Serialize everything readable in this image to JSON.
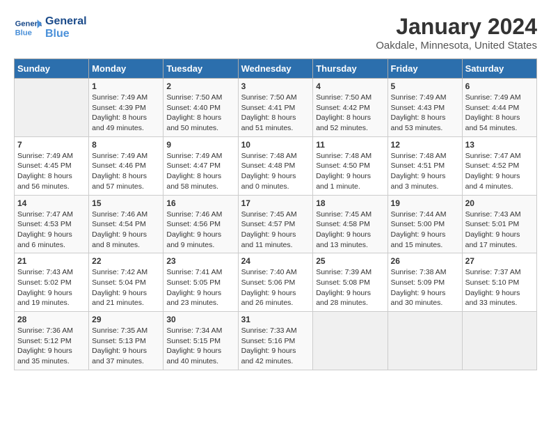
{
  "logo": {
    "line1": "General",
    "line2": "Blue"
  },
  "title": "January 2024",
  "subtitle": "Oakdale, Minnesota, United States",
  "header_days": [
    "Sunday",
    "Monday",
    "Tuesday",
    "Wednesday",
    "Thursday",
    "Friday",
    "Saturday"
  ],
  "weeks": [
    [
      {
        "day": "",
        "sunrise": "",
        "sunset": "",
        "daylight": ""
      },
      {
        "day": "1",
        "sunrise": "Sunrise: 7:49 AM",
        "sunset": "Sunset: 4:39 PM",
        "daylight": "Daylight: 8 hours and 49 minutes."
      },
      {
        "day": "2",
        "sunrise": "Sunrise: 7:50 AM",
        "sunset": "Sunset: 4:40 PM",
        "daylight": "Daylight: 8 hours and 50 minutes."
      },
      {
        "day": "3",
        "sunrise": "Sunrise: 7:50 AM",
        "sunset": "Sunset: 4:41 PM",
        "daylight": "Daylight: 8 hours and 51 minutes."
      },
      {
        "day": "4",
        "sunrise": "Sunrise: 7:50 AM",
        "sunset": "Sunset: 4:42 PM",
        "daylight": "Daylight: 8 hours and 52 minutes."
      },
      {
        "day": "5",
        "sunrise": "Sunrise: 7:49 AM",
        "sunset": "Sunset: 4:43 PM",
        "daylight": "Daylight: 8 hours and 53 minutes."
      },
      {
        "day": "6",
        "sunrise": "Sunrise: 7:49 AM",
        "sunset": "Sunset: 4:44 PM",
        "daylight": "Daylight: 8 hours and 54 minutes."
      }
    ],
    [
      {
        "day": "7",
        "sunrise": "Sunrise: 7:49 AM",
        "sunset": "Sunset: 4:45 PM",
        "daylight": "Daylight: 8 hours and 56 minutes."
      },
      {
        "day": "8",
        "sunrise": "Sunrise: 7:49 AM",
        "sunset": "Sunset: 4:46 PM",
        "daylight": "Daylight: 8 hours and 57 minutes."
      },
      {
        "day": "9",
        "sunrise": "Sunrise: 7:49 AM",
        "sunset": "Sunset: 4:47 PM",
        "daylight": "Daylight: 8 hours and 58 minutes."
      },
      {
        "day": "10",
        "sunrise": "Sunrise: 7:48 AM",
        "sunset": "Sunset: 4:48 PM",
        "daylight": "Daylight: 9 hours and 0 minutes."
      },
      {
        "day": "11",
        "sunrise": "Sunrise: 7:48 AM",
        "sunset": "Sunset: 4:50 PM",
        "daylight": "Daylight: 9 hours and 1 minute."
      },
      {
        "day": "12",
        "sunrise": "Sunrise: 7:48 AM",
        "sunset": "Sunset: 4:51 PM",
        "daylight": "Daylight: 9 hours and 3 minutes."
      },
      {
        "day": "13",
        "sunrise": "Sunrise: 7:47 AM",
        "sunset": "Sunset: 4:52 PM",
        "daylight": "Daylight: 9 hours and 4 minutes."
      }
    ],
    [
      {
        "day": "14",
        "sunrise": "Sunrise: 7:47 AM",
        "sunset": "Sunset: 4:53 PM",
        "daylight": "Daylight: 9 hours and 6 minutes."
      },
      {
        "day": "15",
        "sunrise": "Sunrise: 7:46 AM",
        "sunset": "Sunset: 4:54 PM",
        "daylight": "Daylight: 9 hours and 8 minutes."
      },
      {
        "day": "16",
        "sunrise": "Sunrise: 7:46 AM",
        "sunset": "Sunset: 4:56 PM",
        "daylight": "Daylight: 9 hours and 9 minutes."
      },
      {
        "day": "17",
        "sunrise": "Sunrise: 7:45 AM",
        "sunset": "Sunset: 4:57 PM",
        "daylight": "Daylight: 9 hours and 11 minutes."
      },
      {
        "day": "18",
        "sunrise": "Sunrise: 7:45 AM",
        "sunset": "Sunset: 4:58 PM",
        "daylight": "Daylight: 9 hours and 13 minutes."
      },
      {
        "day": "19",
        "sunrise": "Sunrise: 7:44 AM",
        "sunset": "Sunset: 5:00 PM",
        "daylight": "Daylight: 9 hours and 15 minutes."
      },
      {
        "day": "20",
        "sunrise": "Sunrise: 7:43 AM",
        "sunset": "Sunset: 5:01 PM",
        "daylight": "Daylight: 9 hours and 17 minutes."
      }
    ],
    [
      {
        "day": "21",
        "sunrise": "Sunrise: 7:43 AM",
        "sunset": "Sunset: 5:02 PM",
        "daylight": "Daylight: 9 hours and 19 minutes."
      },
      {
        "day": "22",
        "sunrise": "Sunrise: 7:42 AM",
        "sunset": "Sunset: 5:04 PM",
        "daylight": "Daylight: 9 hours and 21 minutes."
      },
      {
        "day": "23",
        "sunrise": "Sunrise: 7:41 AM",
        "sunset": "Sunset: 5:05 PM",
        "daylight": "Daylight: 9 hours and 23 minutes."
      },
      {
        "day": "24",
        "sunrise": "Sunrise: 7:40 AM",
        "sunset": "Sunset: 5:06 PM",
        "daylight": "Daylight: 9 hours and 26 minutes."
      },
      {
        "day": "25",
        "sunrise": "Sunrise: 7:39 AM",
        "sunset": "Sunset: 5:08 PM",
        "daylight": "Daylight: 9 hours and 28 minutes."
      },
      {
        "day": "26",
        "sunrise": "Sunrise: 7:38 AM",
        "sunset": "Sunset: 5:09 PM",
        "daylight": "Daylight: 9 hours and 30 minutes."
      },
      {
        "day": "27",
        "sunrise": "Sunrise: 7:37 AM",
        "sunset": "Sunset: 5:10 PM",
        "daylight": "Daylight: 9 hours and 33 minutes."
      }
    ],
    [
      {
        "day": "28",
        "sunrise": "Sunrise: 7:36 AM",
        "sunset": "Sunset: 5:12 PM",
        "daylight": "Daylight: 9 hours and 35 minutes."
      },
      {
        "day": "29",
        "sunrise": "Sunrise: 7:35 AM",
        "sunset": "Sunset: 5:13 PM",
        "daylight": "Daylight: 9 hours and 37 minutes."
      },
      {
        "day": "30",
        "sunrise": "Sunrise: 7:34 AM",
        "sunset": "Sunset: 5:15 PM",
        "daylight": "Daylight: 9 hours and 40 minutes."
      },
      {
        "day": "31",
        "sunrise": "Sunrise: 7:33 AM",
        "sunset": "Sunset: 5:16 PM",
        "daylight": "Daylight: 9 hours and 42 minutes."
      },
      {
        "day": "",
        "sunrise": "",
        "sunset": "",
        "daylight": ""
      },
      {
        "day": "",
        "sunrise": "",
        "sunset": "",
        "daylight": ""
      },
      {
        "day": "",
        "sunrise": "",
        "sunset": "",
        "daylight": ""
      }
    ]
  ]
}
